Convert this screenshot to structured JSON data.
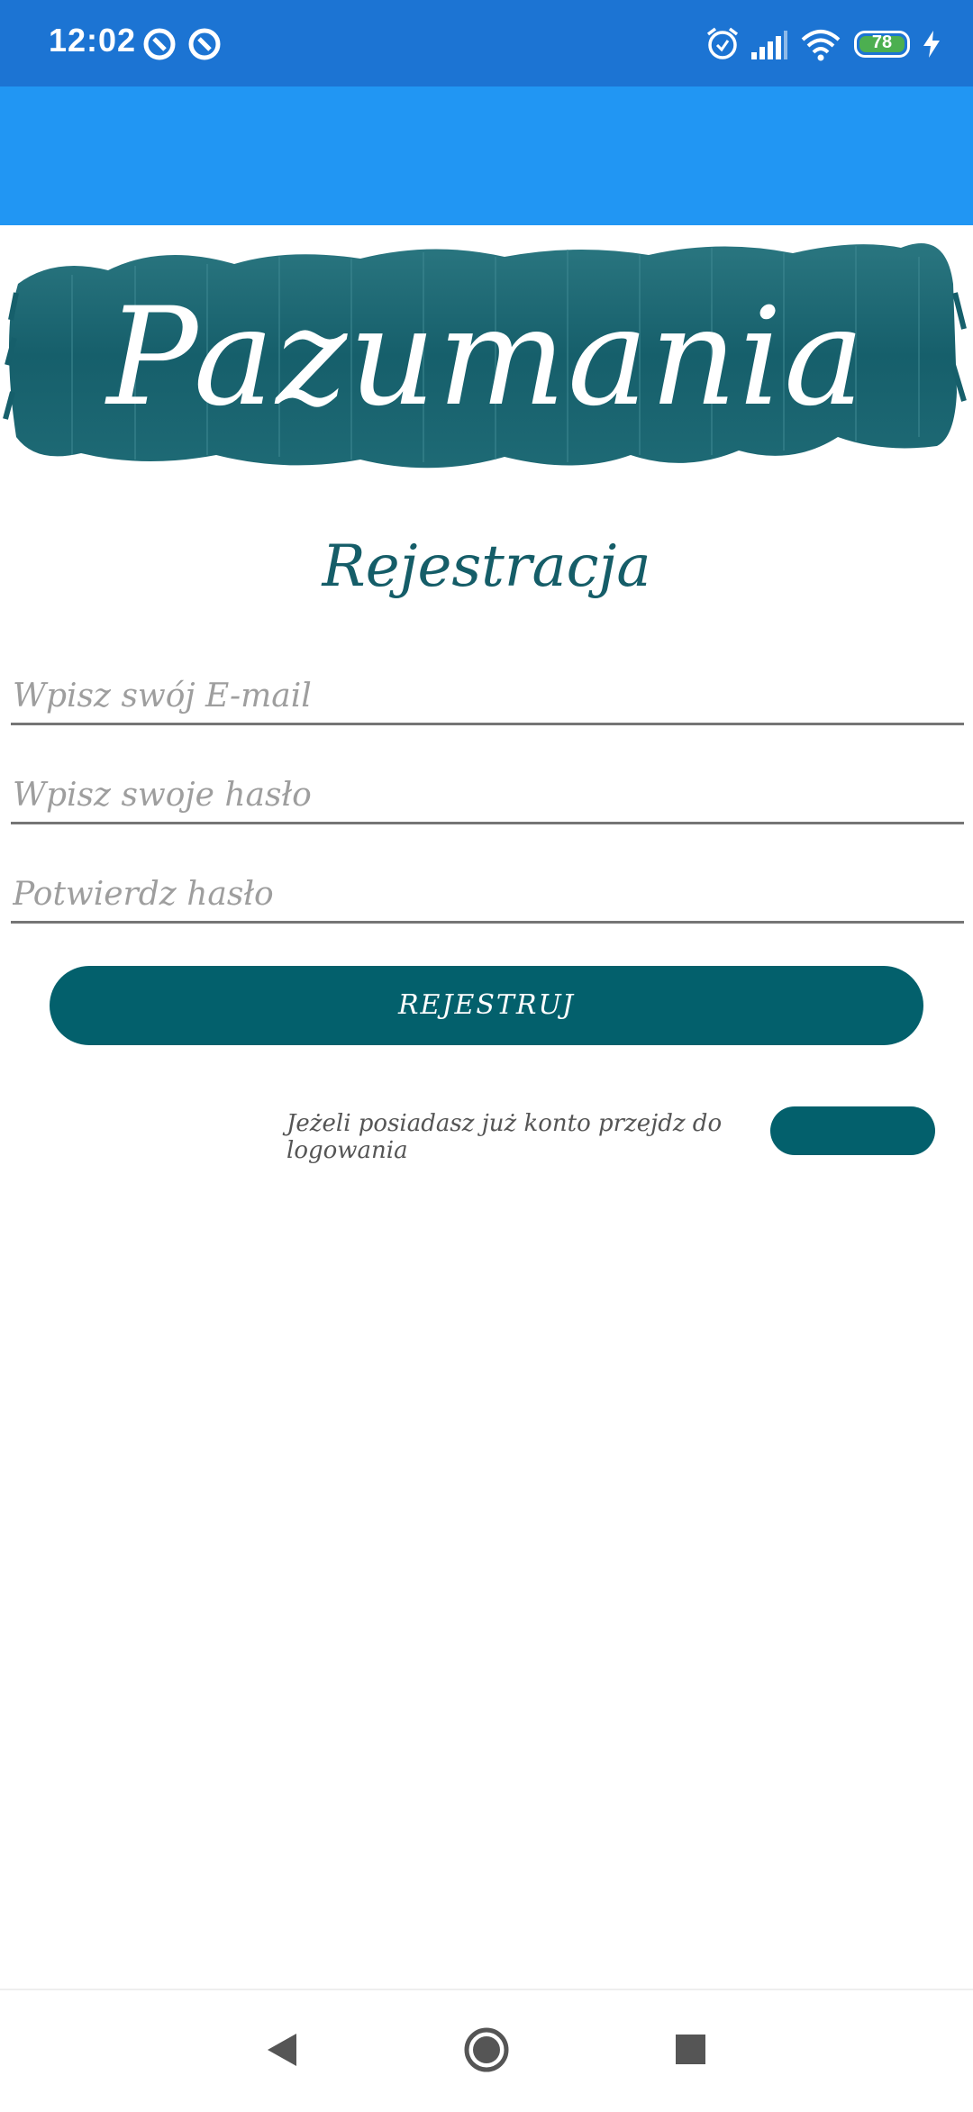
{
  "status_bar": {
    "time": "12:02",
    "battery": "78",
    "icons": [
      "notification-icon",
      "notification-icon",
      "alarm-icon",
      "signal-icon",
      "wifi-icon",
      "battery-icon",
      "charging-icon"
    ]
  },
  "logo": {
    "text": "Pazumania",
    "brush_color": "#165f6b"
  },
  "page": {
    "title": "Rejestracja"
  },
  "form": {
    "email_placeholder": "Wpisz swój E-mail",
    "password_placeholder": "Wpisz swoje hasło",
    "confirm_placeholder": "Potwierdz hasło",
    "register_label": "REJESTRUJ"
  },
  "login": {
    "hint": "Jeżeli posiadasz już konto przejdz do logowania",
    "button_label": ""
  },
  "nav": {
    "back": "back-icon",
    "home": "home-icon",
    "recents": "recents-icon"
  },
  "colors": {
    "status_bar": "#1c74d3",
    "app_bar": "#2196f3",
    "accent": "#03606c",
    "battery_fill": "#4caf50"
  }
}
